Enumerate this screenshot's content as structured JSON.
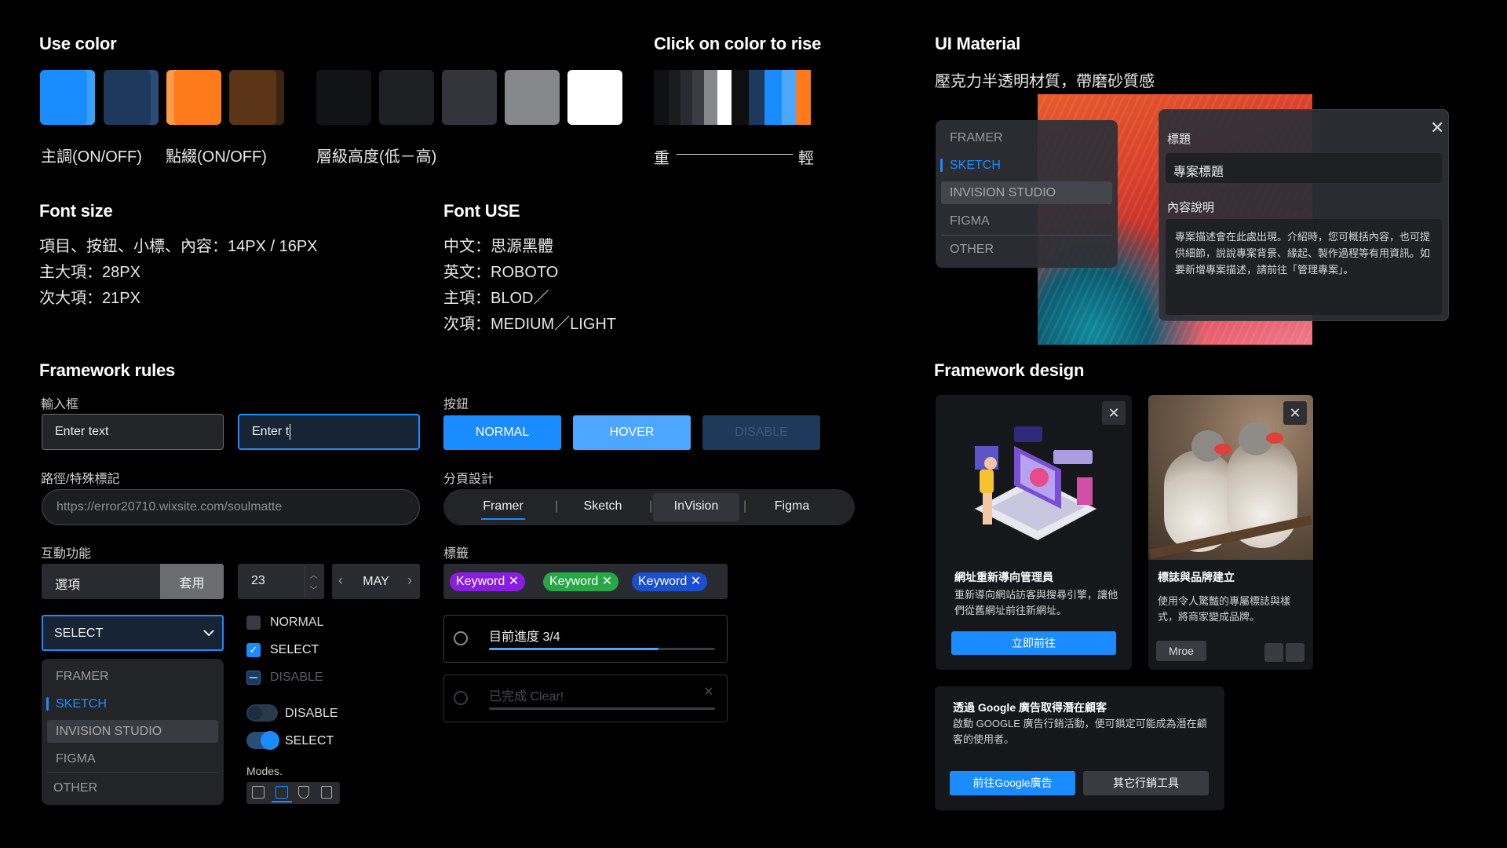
{
  "use_color": {
    "title": "Use color",
    "swatches": [
      "#1a8cff",
      "#1d3a5c",
      "#ff7a1a",
      "#5c3518",
      "#121316",
      "#1f2024",
      "#33353b",
      "#86878b",
      "#ffffff"
    ],
    "label_main": "主調(ON/OFF)",
    "label_accent": "點綴(ON/OFF)",
    "label_levels": "層級高度(低－高)"
  },
  "rise": {
    "title": "Click on color to rise",
    "heavy": "重",
    "light": "輕",
    "strip": [
      "#101114",
      "#1b1c20",
      "#2a2b30",
      "#3a3c42",
      "#86878b",
      "#ffffff",
      "#0f0f10",
      "#1d3a5c",
      "#1a8cff",
      "#4da6ff",
      "#ff7a1a"
    ]
  },
  "ui_material": {
    "title": "UI Material",
    "subtitle": "壓克力半透明材質，帶磨砂質感",
    "menu": [
      "FRAMER",
      "SKETCH",
      "INVISION STUDIO",
      "FIGMA",
      "OTHER"
    ],
    "dialog": {
      "field_label": "標題",
      "field_value": "專案標題",
      "desc_label": "內容說明",
      "desc_text": "專案描述會在此處出現。介紹時，您可概括內容，也可提供細節，說說專案背景、緣起、製作過程等有用資訊。如要新增專案描述，請前往「管理專案」。"
    }
  },
  "font_size": {
    "title": "Font size",
    "lines": [
      "項目、按鈕、小標、內容：14PX / 16PX",
      "主大項：28PX",
      "次大項：21PX"
    ]
  },
  "font_use": {
    "title": "Font USE",
    "lines": [
      "中文：思源黑體",
      "英文：ROBOTO",
      "主項：BLOD／",
      "次項：MEDIUM／LIGHT"
    ]
  },
  "framework_rules": {
    "title": "Framework rules",
    "input_label": "輸入框",
    "input1": "Enter text",
    "input2": "Enter t",
    "path_label": "路徑/特殊標記",
    "path_value": "https://error20710.wixsite.com/soulmatte",
    "interactive_label": "互動功能",
    "option_label": "選項",
    "apply_label": "套用",
    "stepper_value": "23",
    "month_value": "MAY",
    "select_value": "SELECT",
    "dropdown": [
      "FRAMER",
      "SKETCH",
      "INVISION STUDIO",
      "FIGMA",
      "OTHER"
    ],
    "checks": [
      "NORMAL",
      "SELECT",
      "DISABLE"
    ],
    "toggles": [
      "DISABLE",
      "SELECT"
    ],
    "modes_label": "Modes.",
    "button_label": "按鈕",
    "buttons": [
      "NORMAL",
      "HOVER",
      "DISABLE"
    ],
    "pagination_label": "分頁設計",
    "tabs": [
      "Framer",
      "Sketch",
      "InVision",
      "Figma"
    ],
    "tags_label": "標籤",
    "tags": [
      {
        "text": "Keyword",
        "color": "#8a1be0"
      },
      {
        "text": "Keyword",
        "color": "#27a845"
      },
      {
        "text": "Keyword",
        "color": "#1a4fd0"
      }
    ],
    "progress_text": "目前進度 3/4",
    "progress": 0.75,
    "done_text": "已完成 Clear!"
  },
  "framework_design": {
    "title": "Framework design",
    "card1": {
      "title": "網址重新導向管理員",
      "desc": "重新導向網站訪客與搜尋引擎，讓他們從舊網址前往新網址。",
      "button": "立即前往"
    },
    "card2": {
      "title": "標誌與品牌建立",
      "desc": "使用令人驚豔的專屬標誌與樣式，將商家變成品牌。",
      "button": "Mroe"
    },
    "card3": {
      "title": "透過 Google 廣告取得潛在顧客",
      "desc": "啟動 GOOGLE 廣告行銷活動，便可鎖定可能成為潛在顧客的使用者。",
      "button1": "前往Google廣告",
      "button2": "其它行銷工具"
    }
  }
}
